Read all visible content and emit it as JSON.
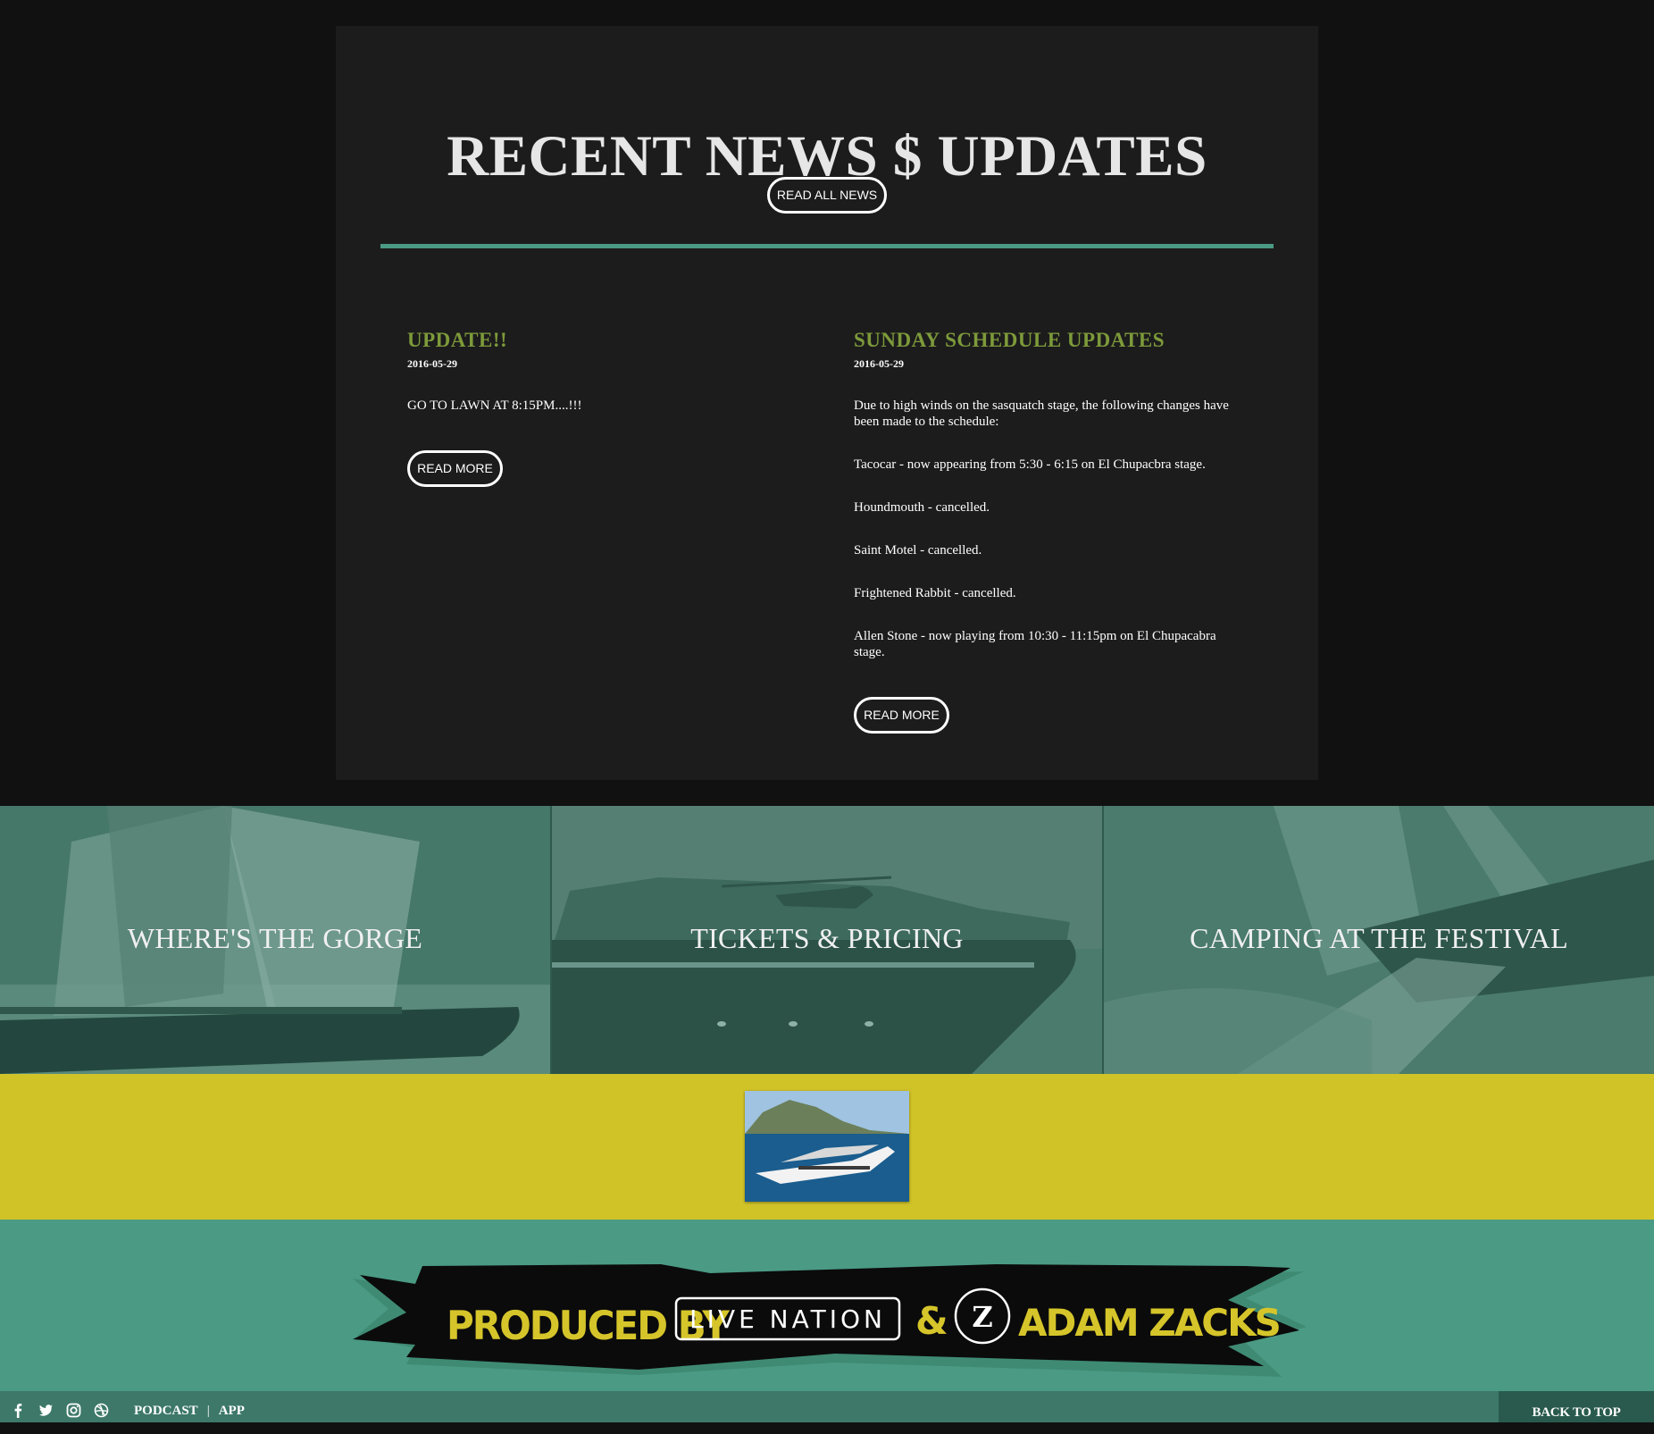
{
  "news": {
    "title": "RECENT NEWS $ UPDATES",
    "read_all_label": "READ ALL NEWS",
    "articles": [
      {
        "title": "UPDATE!!",
        "date": "2016-05-29",
        "paragraphs": [
          "GO TO LAWN AT 8:15PM....!!!"
        ],
        "read_more_label": "READ MORE"
      },
      {
        "title": "SUNDAY SCHEDULE UPDATES",
        "date": "2016-05-29",
        "paragraphs": [
          "Due to high winds on the sasquatch stage, the following changes have been made to the schedule:",
          "Tacocar - now appearing from 5:30 - 6:15 on El Chupacbra stage.",
          "Houndmouth - cancelled.",
          "Saint Motel - cancelled.",
          "Frightened Rabbit - cancelled.",
          "Allen Stone - now playing from 10:30 - 11:15pm on El Chupacabra stage."
        ],
        "read_more_label": "READ MORE"
      }
    ]
  },
  "tiles": [
    {
      "label": "WHERE'S THE GORGE",
      "image": "sailboat-photo"
    },
    {
      "label": "TICKETS & PRICING",
      "image": "yacht-helicopter-photo"
    },
    {
      "label": "CAMPING AT THE FESTIVAL",
      "image": "racing-sailboat-photo"
    }
  ],
  "produced": {
    "prefix": "PRODUCED BY",
    "partner1": "LIVE NATION",
    "amp": "&",
    "partner2": "ADAM ZACKS",
    "badge": "Z"
  },
  "footer": {
    "social_icons": [
      "facebook-icon",
      "twitter-icon",
      "instagram-icon",
      "dribbble-icon"
    ],
    "links": [
      "PODCAST",
      "APP"
    ],
    "separator": "|",
    "back_to_top": "BACK TO TOP"
  },
  "colors": {
    "page_bg": "#111111",
    "card_bg": "#1c1c1c",
    "accent_teal": "#4a9a84",
    "article_title": "#7d9a3a",
    "tile_tint": "#3b6b5e",
    "banner_yellow": "#d0c328",
    "footer_bg": "#3d7869",
    "back_top_bg": "#295a4d",
    "logo_yellow": "#d6c52a"
  }
}
